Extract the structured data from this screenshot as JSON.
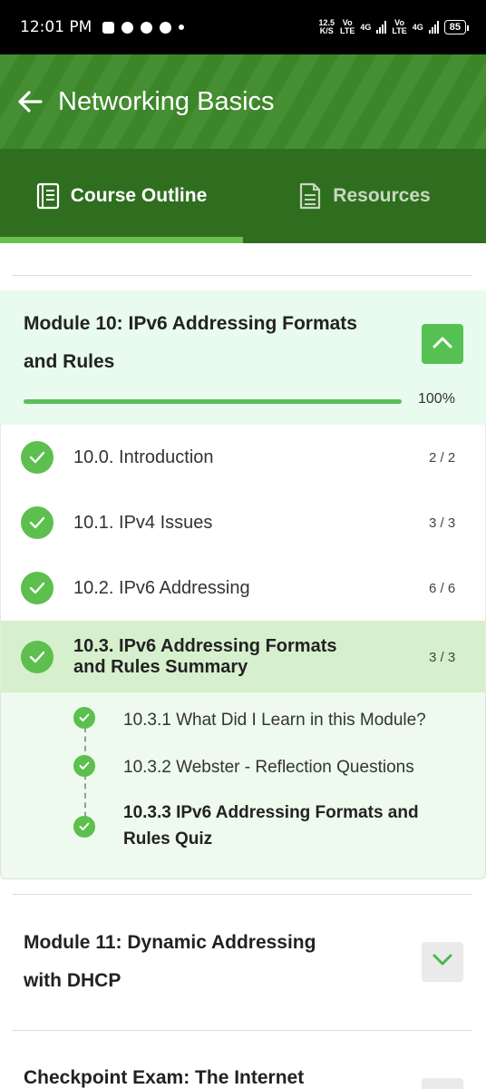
{
  "status_bar": {
    "time": "12:01 PM",
    "net_speed_value": "12.5",
    "net_speed_unit": "K/S",
    "vo_1": "Vo",
    "lte_1": "LTE",
    "g4_1": "4G",
    "vo_2": "Vo",
    "lte_2": "LTE",
    "g4_2": "4G",
    "battery": "85"
  },
  "header": {
    "title": "Networking Basics",
    "back_icon": "arrow-left-icon",
    "tabs": [
      {
        "label": "Course Outline",
        "icon": "book-icon",
        "active": true
      },
      {
        "label": "Resources",
        "icon": "document-icon",
        "active": false
      }
    ]
  },
  "module_10": {
    "title_line1": "Module 10: IPv6 Addressing Formats",
    "title_line2": "and Rules",
    "progress": 1.0,
    "progress_label": "100%",
    "topics": [
      {
        "label": "10.0. Introduction",
        "count": "2 / 2"
      },
      {
        "label": "10.1. IPv4 Issues",
        "count": "3 / 3"
      },
      {
        "label": "10.2. IPv6 Addressing",
        "count": "6 / 6"
      },
      {
        "label_line1": "10.3. IPv6 Addressing Formats",
        "label_line2": "and Rules Summary",
        "count": "3 / 3"
      }
    ],
    "subtopics": [
      {
        "label": "10.3.1 What Did I Learn in this Module?"
      },
      {
        "label": "10.3.2 Webster - Reflection Questions"
      },
      {
        "label_line1": "10.3.3 IPv6 Addressing Formats and",
        "label_line2": "Rules Quiz"
      }
    ]
  },
  "module_11": {
    "title_line1": "Module 11: Dynamic Addressing",
    "title_line2": "with DHCP"
  },
  "checkpoint": {
    "title": "Checkpoint Exam: The Internet"
  },
  "colors": {
    "header_green": "#3e8a2b",
    "tab_bar_green": "#2f6e1f",
    "accent_green": "#5cbf4e",
    "module_bg": "#e8fbee",
    "active_row_bg": "#d6f0cd"
  }
}
